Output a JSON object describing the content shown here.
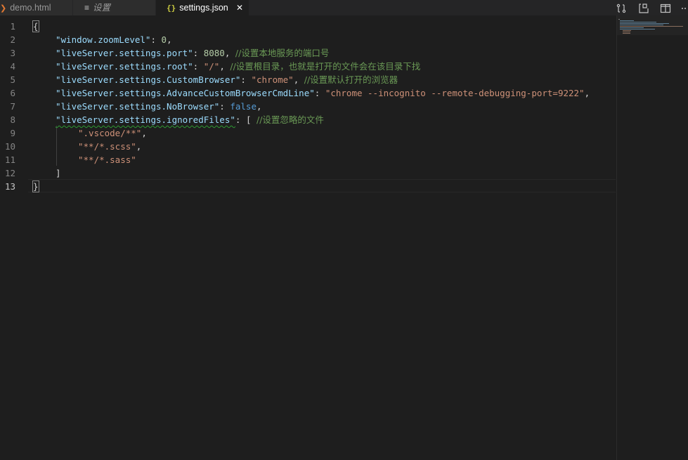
{
  "tabs": [
    {
      "icon": "❯",
      "label": "demo.html"
    },
    {
      "icon": "≡",
      "label": "设置"
    },
    {
      "icon": "{}",
      "label": "settings.json",
      "close": "✕"
    }
  ],
  "line_numbers": [
    "1",
    "2",
    "3",
    "4",
    "5",
    "6",
    "7",
    "8",
    "9",
    "10",
    "11",
    "12",
    "13"
  ],
  "code": {
    "l1": {
      "brace": "{"
    },
    "l2": {
      "key": "\"window.zoomLevel\"",
      "colon": ": ",
      "value": "0",
      "tail": ","
    },
    "l3": {
      "key": "\"liveServer.settings.port\"",
      "colon": ": ",
      "value": "8080",
      "tail": ", ",
      "comment": "//设置本地服务的端口号"
    },
    "l4": {
      "key": "\"liveServer.settings.root\"",
      "colon": ": ",
      "value": "\"/\"",
      "tail": ", ",
      "comment": "//设置根目录，也就是打开的文件会在该目录下找"
    },
    "l5": {
      "key": "\"liveServer.settings.CustomBrowser\"",
      "colon": ": ",
      "value": "\"chrome\"",
      "tail": ", ",
      "comment": "//设置默认打开的浏览器"
    },
    "l6": {
      "key": "\"liveServer.settings.AdvanceCustomBrowserCmdLine\"",
      "colon": ": ",
      "value": "\"chrome --incognito --remote-debugging-port=9222\"",
      "tail": ","
    },
    "l7": {
      "key": "\"liveServer.settings.NoBrowser\"",
      "colon": ": ",
      "value": "false",
      "tail": ","
    },
    "l8": {
      "key": "\"liveServer.settings.ignoredFiles\"",
      "colon": ": ",
      "value": "[ ",
      "comment": "//设置忽略的文件"
    },
    "l9": {
      "value": "\".vscode/**\"",
      "tail": ","
    },
    "l10": {
      "value": "\"**/*.scss\"",
      "tail": ","
    },
    "l11": {
      "value": "\"**/*.sass\""
    },
    "l12": {
      "value": "]"
    },
    "l13": {
      "brace": "}"
    }
  },
  "colors": {
    "key": "#9cdcfe",
    "string": "#ce9178",
    "number": "#b5cea8",
    "boolean": "#569cd6",
    "comment": "#6a9955"
  }
}
